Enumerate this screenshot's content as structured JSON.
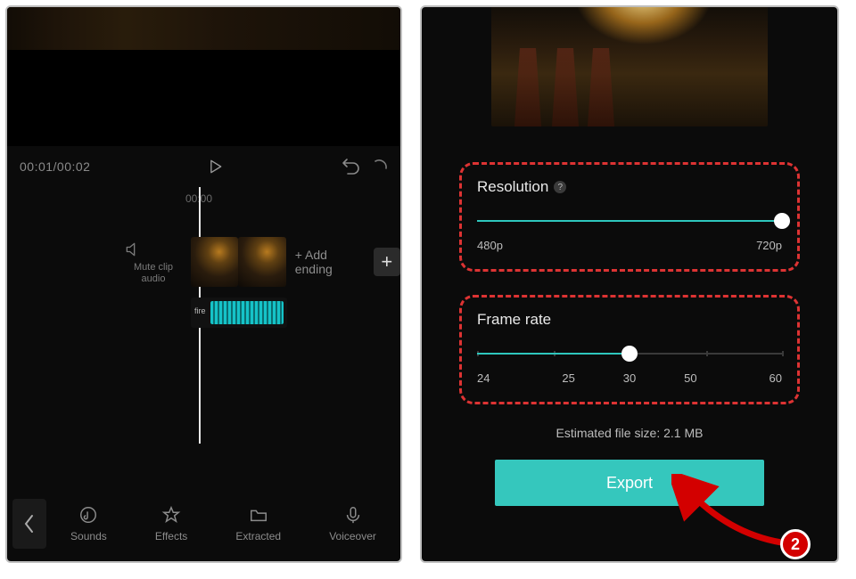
{
  "left": {
    "time_display": "00:01/00:02",
    "ruler_tick": "00:00",
    "mute_label_line1": "Mute clip",
    "mute_label_line2": "audio",
    "add_ending_label": "Add ending",
    "audio_clip_tag": "fire",
    "tabs": {
      "sounds": "Sounds",
      "effects": "Effects",
      "extracted": "Extracted",
      "voiceover": "Voiceover"
    }
  },
  "right": {
    "resolution": {
      "title": "Resolution",
      "min_label": "480p",
      "max_label": "720p",
      "value_pct": 100
    },
    "framerate": {
      "title": "Frame rate",
      "ticks": [
        "24",
        "25",
        "30",
        "50",
        "60"
      ],
      "value_index": 2
    },
    "estimate_label": "Estimated file size: 2.1 MB",
    "export_label": "Export",
    "annotation_number": "2"
  },
  "colors": {
    "accent_teal": "#35c7bd",
    "annotation_red": "#d30000"
  }
}
